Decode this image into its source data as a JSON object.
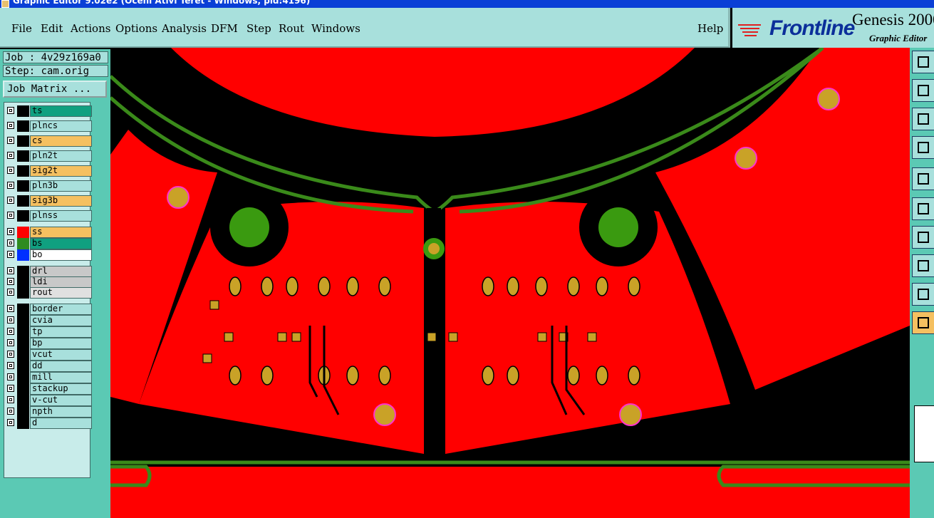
{
  "window": {
    "title": "Graphic Editor 9.02e2 (Oceni Ativi Teret - Windows, pid:4196)"
  },
  "menu": [
    "File",
    "Edit",
    "Actions",
    "Options",
    "Analysis",
    "DFM",
    "Step",
    "Rout",
    "Windows"
  ],
  "help_label": "Help",
  "brand": {
    "logo": "Frontline",
    "product": "Genesis 2000",
    "subtitle": "Graphic Editor"
  },
  "job": {
    "label": "Job : 4v29z169a0",
    "step": "Step: cam.orig",
    "matrix_button": "Job Matrix ..."
  },
  "layers": [
    {
      "name": "ts",
      "color": "#f0b040",
      "swatch": "#000000",
      "highlight": "#10a080"
    },
    {
      "name": "plncs",
      "color": "#a8e0dc",
      "swatch": "#000000"
    },
    {
      "name": "cs",
      "color": "#f5c060",
      "swatch": "#000000"
    },
    {
      "name": "pln2t",
      "color": "#a8e0dc",
      "swatch": "#000000"
    },
    {
      "name": "sig2t",
      "color": "#f5c060",
      "swatch": "#000000"
    },
    {
      "name": "pln3b",
      "color": "#a8e0dc",
      "swatch": "#000000"
    },
    {
      "name": "sig3b",
      "color": "#f5c060",
      "swatch": "#000000"
    },
    {
      "name": "plnss",
      "color": "#a8e0dc",
      "swatch": "#000000"
    },
    {
      "name": "ss",
      "color": "#f5c060",
      "swatch": "#ff0000",
      "active": true
    },
    {
      "name": "bs",
      "color": "#10a080",
      "swatch": "#2e8b20"
    },
    {
      "name": "bo",
      "color": "#ffffff",
      "swatch": "#0030ff"
    },
    {
      "name": "drl",
      "color": "#c8c8c8",
      "swatch": "#000000"
    },
    {
      "name": "ldi",
      "color": "#c8c8c8",
      "swatch": "#000000"
    },
    {
      "name": "rout",
      "color": "#e0e0e0",
      "swatch": "#000000"
    },
    {
      "name": "border",
      "color": "#a8e0dc",
      "swatch": "#000000"
    },
    {
      "name": "cvia",
      "color": "#a8e0dc",
      "swatch": "#000000"
    },
    {
      "name": "tp",
      "color": "#a8e0dc",
      "swatch": "#000000"
    },
    {
      "name": "bp",
      "color": "#a8e0dc",
      "swatch": "#000000"
    },
    {
      "name": "vcut",
      "color": "#a8e0dc",
      "swatch": "#000000"
    },
    {
      "name": "dd",
      "color": "#a8e0dc",
      "swatch": "#000000"
    },
    {
      "name": "mill",
      "color": "#a8e0dc",
      "swatch": "#000000"
    },
    {
      "name": "stackup",
      "color": "#a8e0dc",
      "swatch": "#000000"
    },
    {
      "name": "v-cut",
      "color": "#a8e0dc",
      "swatch": "#000000"
    },
    {
      "name": "npth",
      "color": "#a8e0dc",
      "swatch": "#000000"
    },
    {
      "name": "d",
      "color": "#a8e0dc",
      "swatch": "#000000"
    }
  ],
  "colors": {
    "copper": "#ff0000",
    "pad": "#c9a227",
    "outline": "#3a8a1a",
    "marker": "#ff33cc",
    "background": "#000000"
  },
  "tools": [
    "snapshot-icon",
    "zoom-fit-icon",
    "pan-icon",
    "measure-icon",
    "layer-icon",
    "net-icon",
    "line-icon",
    "color-icon",
    "warning-icon",
    "select-pointer-icon"
  ]
}
